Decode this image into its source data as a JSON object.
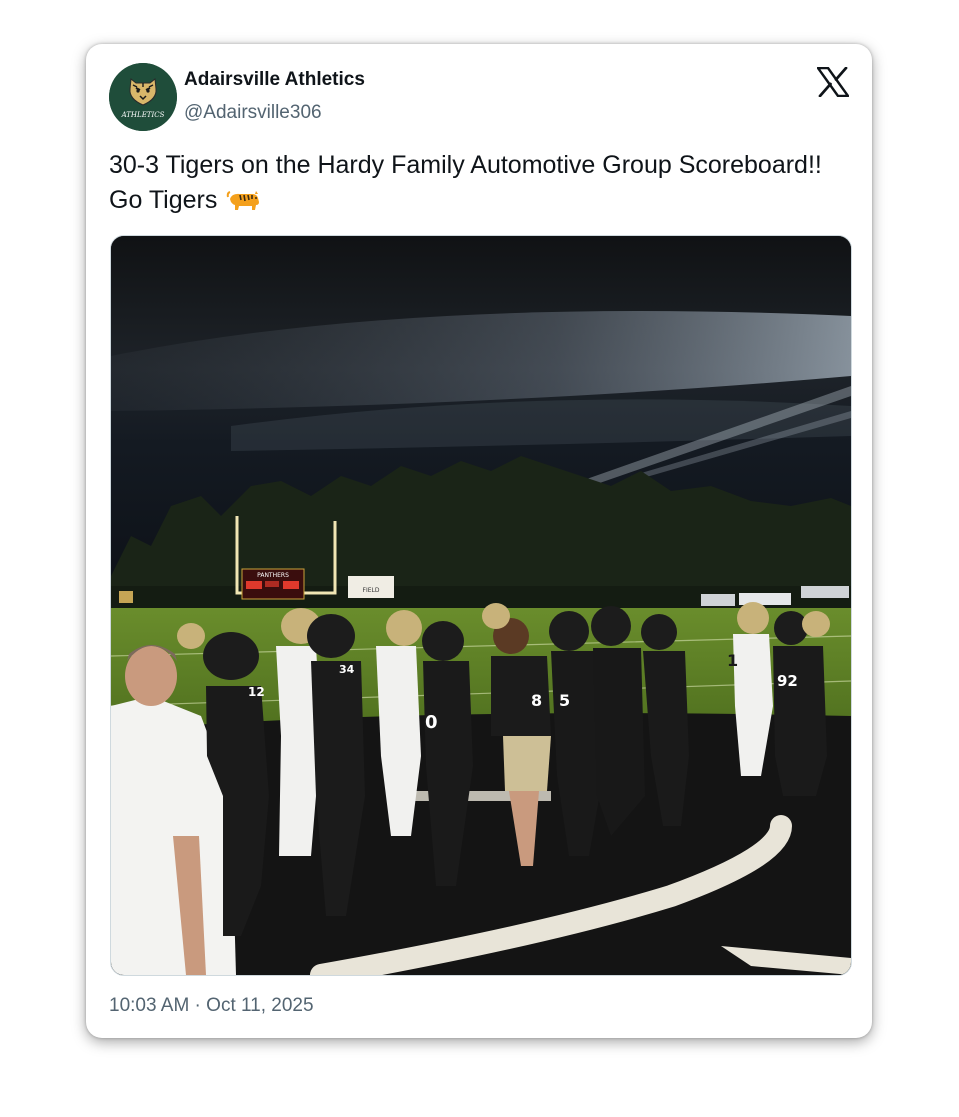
{
  "tweet": {
    "display_name": "Adairsville Athletics",
    "handle": "@Adairsville306",
    "avatar_icon": "tiger-logo-avatar",
    "avatar_script_text": "ATHLETICS",
    "text": "30-3 Tigers on the Hardy Family Automotive Group Scoreboard!! Go Tigers",
    "emoji_icon": "tiger-emoji",
    "timestamp": "10:03 AM · Oct 11, 2025",
    "platform_icon": "x-logo-icon"
  },
  "media": {
    "description_icon": "football-field-photo",
    "scoreboard_text": "PANTHERS",
    "field_sign_text": "FIELD",
    "jersey_numbers": [
      "12",
      "34",
      "0",
      "8",
      "5",
      "1",
      "92"
    ]
  },
  "colors": {
    "avatar_bg": "#1f4d3a",
    "text_primary": "#0f1419",
    "text_secondary": "#536471",
    "card_bg": "#ffffff"
  }
}
